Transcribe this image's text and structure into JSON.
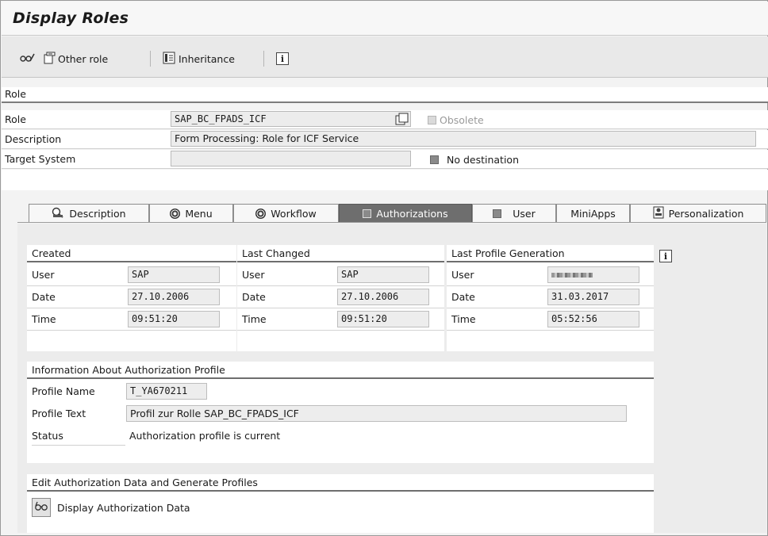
{
  "title": "Display Roles",
  "toolbar": {
    "other_role": "Other role",
    "inheritance": "Inheritance",
    "info": "i"
  },
  "role_section": {
    "header": "Role",
    "role_label": "Role",
    "role_value": "SAP_BC_FPADS_ICF",
    "obsolete_label": "Obsolete",
    "description_label": "Description",
    "description_value": "Form Processing: Role for ICF Service",
    "target_system_label": "Target System",
    "target_system_value": "",
    "no_destination_label": "No destination"
  },
  "tabs": [
    {
      "label": "Description",
      "icon": "description-icon"
    },
    {
      "label": "Menu",
      "icon": "target-icon"
    },
    {
      "label": "Workflow",
      "icon": "target-icon"
    },
    {
      "label": "Authorizations",
      "icon": "checkbox-icon",
      "active": true
    },
    {
      "label": "User",
      "icon": "checkbox-icon"
    },
    {
      "label": "MiniApps",
      "icon": ""
    },
    {
      "label": "Personalization",
      "icon": "personalization-icon"
    }
  ],
  "created": {
    "header": "Created",
    "user_label": "User",
    "user_value": "SAP",
    "date_label": "Date",
    "date_value": "27.10.2006",
    "time_label": "Time",
    "time_value": "09:51:20"
  },
  "last_changed": {
    "header": "Last Changed",
    "user_label": "User",
    "user_value": "SAP",
    "date_label": "Date",
    "date_value": "27.10.2006",
    "time_label": "Time",
    "time_value": "09:51:20"
  },
  "last_profile_generation": {
    "header": "Last Profile Generation",
    "user_label": "User",
    "user_value": "",
    "date_label": "Date",
    "date_value": "31.03.2017",
    "time_label": "Time",
    "time_value": "05:52:56"
  },
  "profile_info": {
    "header": "Information About Authorization Profile",
    "profile_name_label": "Profile Name",
    "profile_name_value": "T_YA670211",
    "profile_text_label": "Profile Text",
    "profile_text_value": "Profil zur Rolle SAP_BC_FPADS_ICF",
    "status_label": "Status",
    "status_value": "Authorization profile is current"
  },
  "edit_auth": {
    "header": "Edit Authorization Data and Generate Profiles",
    "display_label": "Display Authorization Data"
  }
}
